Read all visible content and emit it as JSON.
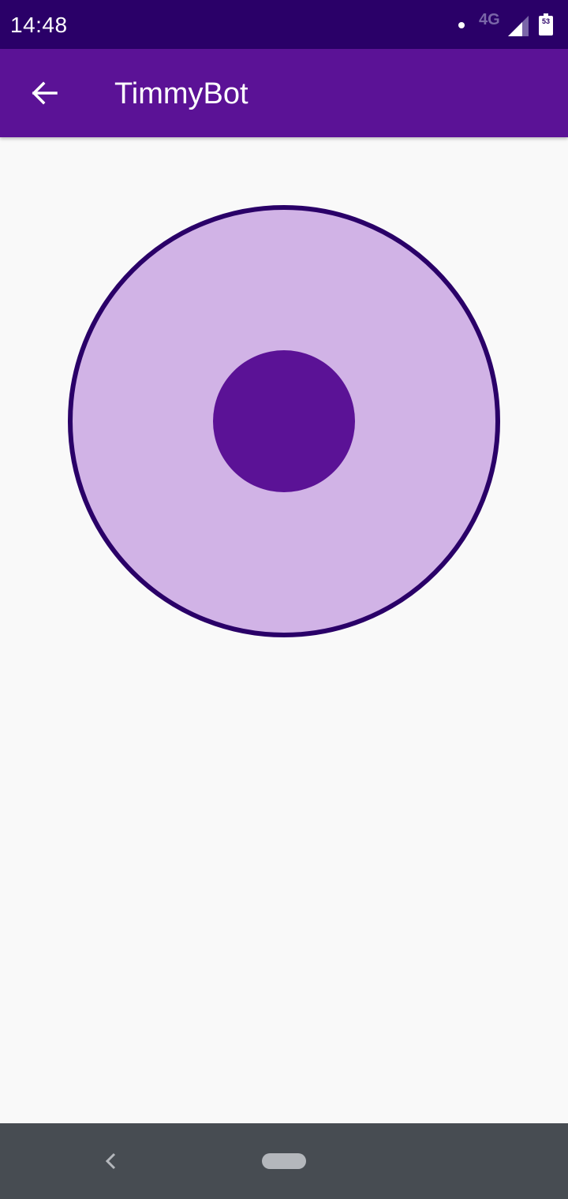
{
  "status_bar": {
    "time": "14:48",
    "network": "4G",
    "battery_level": "53",
    "icons": [
      "notification-dot-icon",
      "cell-signal-icon",
      "battery-icon"
    ],
    "background_color": "#2a0068"
  },
  "app_bar": {
    "title": "TimmyBot",
    "back_icon": "arrow-back-icon",
    "background_color": "#5b1296"
  },
  "joystick": {
    "base_color": "#d1b3e6",
    "border_color": "#2a0068",
    "knob_color": "#5b1296",
    "knob_offset": [
      0,
      0
    ]
  },
  "nav_bar": {
    "icons": [
      "nav-back-icon",
      "nav-home-pill"
    ],
    "background_color": "#474c52"
  }
}
